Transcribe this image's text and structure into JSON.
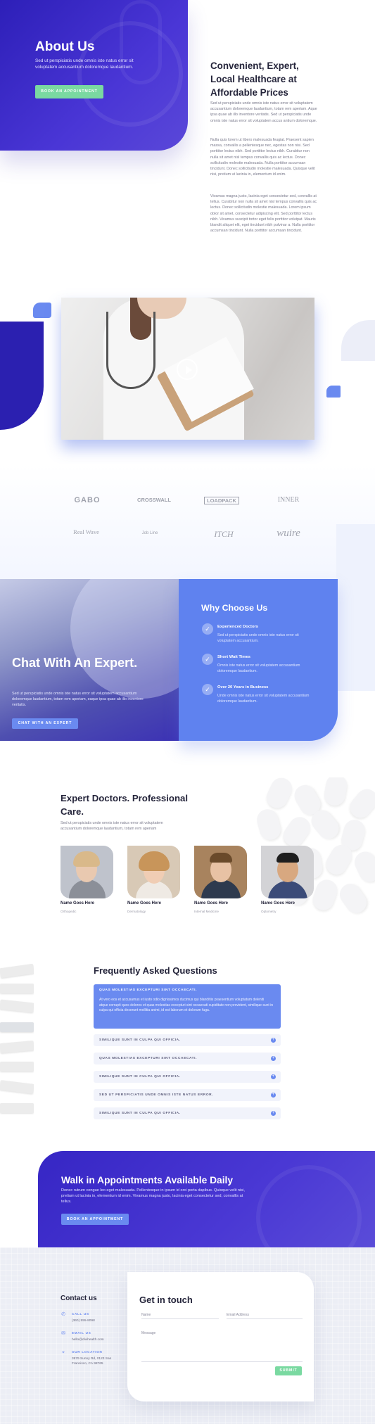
{
  "colors": {
    "brand_indigo": "#3626c4",
    "accent_blue": "#6a8af0",
    "accent_green": "#7ad9a1",
    "heading": "#24243a"
  },
  "hero": {
    "title": "About Us",
    "text": "Sed ut perspiciatis unde omnis iste natus error sit voluptatem accusantium doloremque laudantium.",
    "button": "BOOK AN APPOINTMENT"
  },
  "intro": {
    "title": "Convenient, Expert, Local Healthcare at Affordable Prices",
    "p1": "Sed ut perspiciatis unde omnis iste natus error sit voluptatem accusantium doloremque laudantium, totam rem aperiam. Aque ipsa quae ab illo inventore veritatis. Sed ut perspiciatis unde omnis iste natus error sit voluptatem accus antium doloremque.",
    "p2": "Nulla quis lorem ut libero malesuada feugiat. Praesent sapien massa, convallis a pellentesque nec, egestas non nisi. Sed porttitor lectus nibh. Sed porttitor lectus nibh. Curabitur non nulla sit amet nisl tempus convallis quis ac lectus. Donec sollicitudin molestie malesuada. Nulla porttitor accumsan tincidunt. Donec sollicitudin molestie malesuada. Quisque velit nisi, pretium ut lacinia in, elementum id enim.",
    "p3": "Vivamus magna justo, lacinia eget consectetur sed, convallis at tellus. Curabitur non nulla sit amet nisl tempus convallis quis ac lectus. Donec sollicitudin molestie malesuada. Lorem ipsum dolor sit amet, consectetur adipiscing elit. Sed porttitor lectus nibh. Vivamus suscipit tortor eget felis porttitor volutpat. Mauris blandit aliquet elit, eget tincidunt nibh pulvinar a. Nulla porttitor accumsan tincidunt. Nulla porttitor accumsan tincidunt."
  },
  "video": {
    "play_icon": "play-icon"
  },
  "logos": [
    "GABO",
    "CROSSWALL",
    "LOADPACK",
    "INNER",
    "Real Wave",
    "Job Line",
    "ITCH",
    "wuire"
  ],
  "chat": {
    "title": "Chat With An Expert.",
    "text": "Sed ut perspiciatis unde omnis iste natus error sit voluptatem accusantium doloremque laudantium, totam rem aperiam, eaque ipsa quae ab illo inventore veritatis.",
    "button": "CHAT WITH AN EXPERT"
  },
  "why": {
    "title": "Why Choose Us",
    "items": [
      {
        "title": "Experienced Doctors",
        "text": "Sed ut perspiciatis unde omnis iste natus error sit voluptatem accusantium."
      },
      {
        "title": "Short Wait Times",
        "text": "Omnis iste natus error sit voluptatem accusantium doloremque laudantium."
      },
      {
        "title": "Over 20 Years in Business",
        "text": "Unde omnis iste natus error sit voluptatem accusantium doloremque laudantium."
      }
    ]
  },
  "doctors": {
    "title": "Expert Doctors. Professional Care.",
    "text": "Sed ut perspiciatis unde omnis iste natus error sit voluptatem accusantium doloremque laudantium, totam rem aperiam",
    "list": [
      {
        "name": "Name Goes Here",
        "role": "Orthopedic"
      },
      {
        "name": "Name Goes Here",
        "role": "Dermatology"
      },
      {
        "name": "Name Goes Here",
        "role": "Internal Medicine"
      },
      {
        "name": "Name Goes Here",
        "role": "Optometry"
      }
    ]
  },
  "faq": {
    "title": "Frequently Asked Questions",
    "open_question": "QUAS MOLESTIAS EXCEPTURI SINT OCCAECATI.",
    "open_answer": "At vero eos et accusamus et iusto odio dignissimos ducimus qui blanditiis praesentium voluptatum deleniti atque corrupti quos dolores et quas molestias excepturi sint occaecati cupiditate non provident, similique sunt in culpa qui officia deserunt mollitia animi, id est laborum et dolorum fuga.",
    "items": [
      "SIMILIQUE SUNT IN CULPA QUI OFFICIA.",
      "QUAS MOLESTIAS EXCEPTURI SINT OCCAECATI.",
      "SIMILIQUE SUNT IN CULPA QUI OFFICIA.",
      "SED UT PERSPICIATIS UNDE OMNIS ISTE NATUS ERROR.",
      "SIMILIQUE SUNT IN CULPA QUI OFFICIA."
    ]
  },
  "walkin": {
    "title": "Walk in Appointments Available Daily",
    "text": "Donec rutrum congue leo eget malesuada. Pellentesque in ipsum id orci porta dapibus. Quisque velit nisi, pretium ut lacinia in, elementum id enim. Vivamus magna justo, lacinia eget consectetur sed, convallis at tellus.",
    "button": "BOOK AN APPOINTMENT"
  },
  "contact": {
    "title": "Contact us",
    "call_label": "CALL US",
    "call_value": "(360) 555-8098",
    "email_label": "EMAIL US",
    "email_value": "hello@divihealth.com",
    "location_label": "OUR LOCATION",
    "location_value": "3879 Sunny Rd, #123 San Francisco, CA 98765"
  },
  "form": {
    "title": "Get in touch",
    "name_placeholder": "Name",
    "email_placeholder": "Email Address",
    "message_placeholder": "Message",
    "submit": "SUBMIT"
  }
}
